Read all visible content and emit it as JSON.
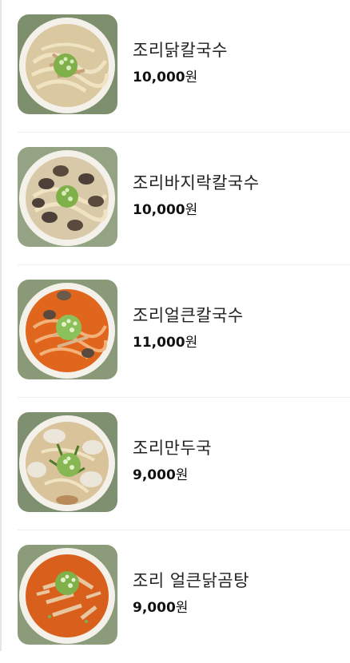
{
  "menu": {
    "items": [
      {
        "name": "조리닭칼국수",
        "price": "10,000",
        "unit": "원",
        "image": "chicken-kalguksu-bowl",
        "broth_color": "#d9c8a0"
      },
      {
        "name": "조리바지락칼국수",
        "price": "10,000",
        "unit": "원",
        "image": "clam-kalguksu-bowl",
        "broth_color": "#d8c9a8"
      },
      {
        "name": "조리얼큰칼국수",
        "price": "11,000",
        "unit": "원",
        "image": "spicy-kalguksu-bowl",
        "broth_color": "#e0661e"
      },
      {
        "name": "조리만두국",
        "price": "9,000",
        "unit": "원",
        "image": "dumpling-soup-bowl",
        "broth_color": "#d8c39a"
      },
      {
        "name": "조리 얼큰닭곰탕",
        "price": "9,000",
        "unit": "원",
        "image": "spicy-chicken-gomtang-bowl",
        "broth_color": "#d9601c"
      }
    ]
  }
}
